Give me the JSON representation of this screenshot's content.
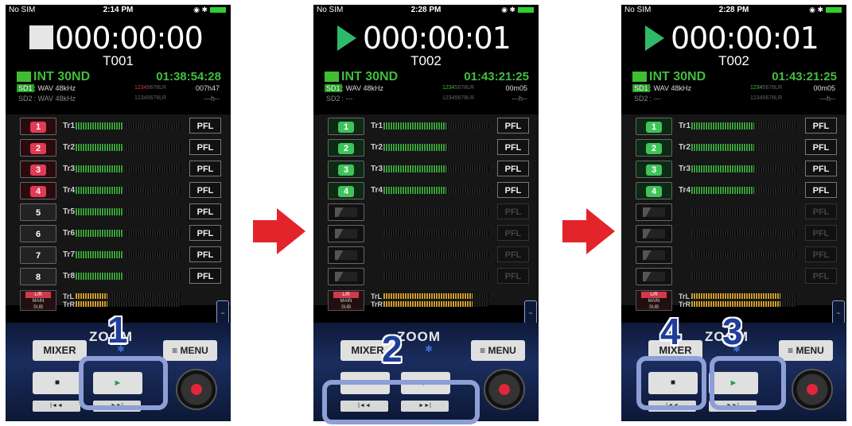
{
  "arrows": [
    "arrow-1",
    "arrow-2"
  ],
  "screens": [
    {
      "status": {
        "carrier": "No SIM",
        "time": "2:14 PM"
      },
      "transport": "stop",
      "counter": "000:00:00",
      "take": "T001",
      "media": "INT 30ND",
      "remaining": "01:38:54:28",
      "sd1": {
        "label": "SD1",
        "format": ": WAV 48kHz",
        "right": "007h47"
      },
      "sd2": {
        "label": "SD2",
        "format": ": WAV 48kHz",
        "right": "---h--"
      },
      "tracks": [
        {
          "btn": "1",
          "label": "Tr1",
          "level": 0.45,
          "pfl": "PFL"
        },
        {
          "btn": "2",
          "label": "Tr2",
          "level": 0.45,
          "pfl": "PFL"
        },
        {
          "btn": "3",
          "label": "Tr3",
          "level": 0.45,
          "pfl": "PFL"
        },
        {
          "btn": "4",
          "label": "Tr4",
          "level": 0.45,
          "pfl": "PFL"
        },
        {
          "btn": "5",
          "label": "Tr5",
          "level": 0.45,
          "pfl": "PFL"
        },
        {
          "btn": "6",
          "label": "Tr6",
          "level": 0.45,
          "pfl": "PFL"
        },
        {
          "btn": "7",
          "label": "Tr7",
          "level": 0.45,
          "pfl": "PFL"
        },
        {
          "btn": "8",
          "label": "Tr8",
          "level": 0.45,
          "pfl": "PFL"
        }
      ],
      "lr": {
        "top": "L/R",
        "mid": "MAIN",
        "bot": "SUB",
        "l": "TrL",
        "r": "TrR",
        "level": 0.3
      },
      "brand": "ZOOM",
      "mixer": "MIXER",
      "menu": "≡ MENU",
      "callout": "1"
    },
    {
      "status": {
        "carrier": "No SIM",
        "time": "2:28 PM"
      },
      "transport": "play",
      "counter": "000:00:01",
      "take": "T002",
      "media": "INT 30ND",
      "remaining": "01:43:21:25",
      "sd1": {
        "label": "SD1",
        "format": ": WAV 48kHz",
        "right": "00m05"
      },
      "sd2": {
        "label": "SD2",
        "format": ": ---",
        "right": "---h--"
      },
      "tracks": [
        {
          "btn": "1",
          "label": "Tr1",
          "level": 0.6,
          "pfl": "PFL"
        },
        {
          "btn": "2",
          "label": "Tr2",
          "level": 0.6,
          "pfl": "PFL"
        },
        {
          "btn": "3",
          "label": "Tr3",
          "level": 0.6,
          "pfl": "PFL"
        },
        {
          "btn": "4",
          "label": "Tr4",
          "level": 0.6,
          "pfl": "PFL"
        },
        {
          "btn": "",
          "label": "",
          "level": 0,
          "pfl": "PFL"
        },
        {
          "btn": "",
          "label": "",
          "level": 0,
          "pfl": "PFL"
        },
        {
          "btn": "",
          "label": "",
          "level": 0,
          "pfl": "PFL"
        },
        {
          "btn": "",
          "label": "",
          "level": 0,
          "pfl": "PFL"
        }
      ],
      "lr": {
        "top": "L/R",
        "mid": "MAIN",
        "bot": "SUB",
        "l": "TrL",
        "r": "TrR",
        "level": 0.85
      },
      "brand": "ZOOM",
      "mixer": "MIXER",
      "menu": "≡ MENU",
      "callout": "2"
    },
    {
      "status": {
        "carrier": "No SIM",
        "time": "2:28 PM"
      },
      "transport": "play",
      "counter": "000:00:01",
      "take": "T002",
      "media": "INT 30ND",
      "remaining": "01:43:21:25",
      "sd1": {
        "label": "SD1",
        "format": ": WAV 48kHz",
        "right": "00m05"
      },
      "sd2": {
        "label": "SD2",
        "format": ": ---",
        "right": "---h--"
      },
      "tracks": [
        {
          "btn": "1",
          "label": "Tr1",
          "level": 0.6,
          "pfl": "PFL"
        },
        {
          "btn": "2",
          "label": "Tr2",
          "level": 0.6,
          "pfl": "PFL"
        },
        {
          "btn": "3",
          "label": "Tr3",
          "level": 0.6,
          "pfl": "PFL"
        },
        {
          "btn": "4",
          "label": "Tr4",
          "level": 0.6,
          "pfl": "PFL"
        },
        {
          "btn": "",
          "label": "",
          "level": 0,
          "pfl": "PFL"
        },
        {
          "btn": "",
          "label": "",
          "level": 0,
          "pfl": "PFL"
        },
        {
          "btn": "",
          "label": "",
          "level": 0,
          "pfl": "PFL"
        },
        {
          "btn": "",
          "label": "",
          "level": 0,
          "pfl": "PFL"
        }
      ],
      "lr": {
        "top": "L/R",
        "mid": "MAIN",
        "bot": "SUB",
        "l": "TrL",
        "r": "TrR",
        "level": 0.85
      },
      "brand": "ZOOM",
      "mixer": "MIXER",
      "menu": "≡ MENU",
      "callout": "3",
      "callout2": "4"
    }
  ]
}
